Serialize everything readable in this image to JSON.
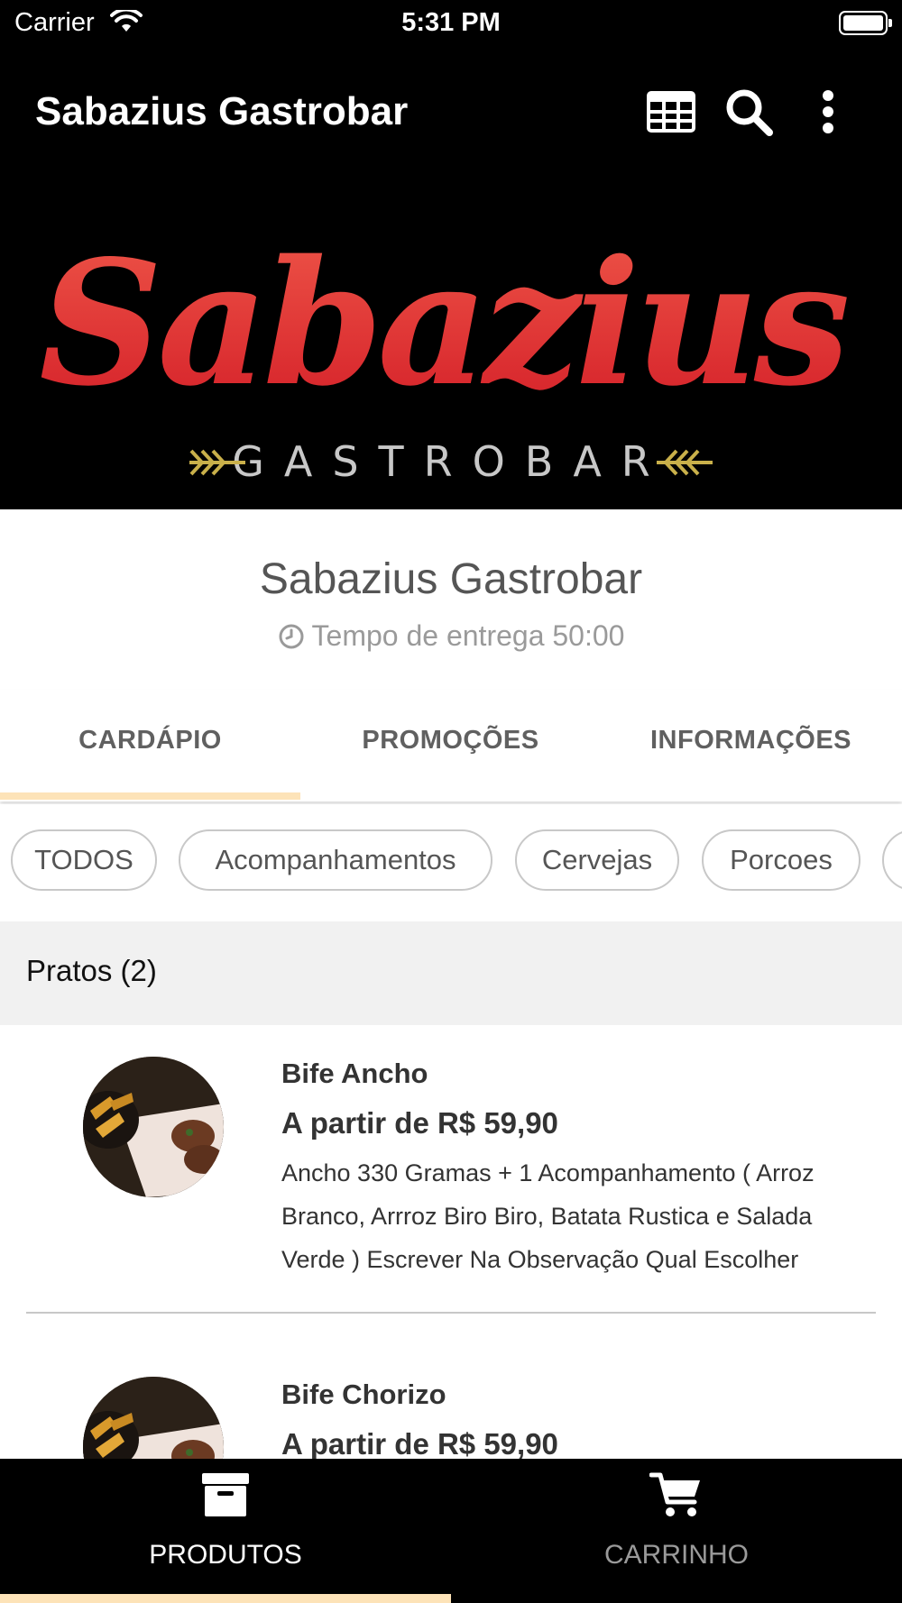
{
  "status_bar": {
    "carrier": "Carrier",
    "time": "5:31 PM"
  },
  "app_bar": {
    "title": "Sabazius Gastrobar"
  },
  "banner": {
    "logo_script": "Sabazius",
    "logo_subtitle": "GASTROBAR"
  },
  "store": {
    "name": "Sabazius Gastrobar",
    "delivery_time": "Tempo de entrega 50:00"
  },
  "tabs": [
    {
      "label": "CARDÁPIO",
      "active": true
    },
    {
      "label": "PROMOÇÕES",
      "active": false
    },
    {
      "label": "INFORMAÇÕES",
      "active": false
    }
  ],
  "categories": [
    "TODOS",
    "Acompanhamentos",
    "Cervejas",
    "Porcoes"
  ],
  "section": {
    "title": "Pratos (2)"
  },
  "products": [
    {
      "name": "Bife Ancho",
      "price": "A partir de R$ 59,90",
      "description": "Ancho 330 Gramas + 1 Acompanhamento ( Arroz Branco, Arrroz Biro Biro, Batata Rustica e Salada Verde ) Escrever Na Observação Qual Escolher"
    },
    {
      "name": "Bife Chorizo",
      "price": "A partir de R$ 59,90"
    }
  ],
  "bottom_nav": [
    {
      "label": "PRODUTOS",
      "icon": "archive-box-icon",
      "active": true
    },
    {
      "label": "CARRINHO",
      "icon": "cart-icon",
      "active": false
    }
  ],
  "colors": {
    "header_bg": "#000000",
    "active_indicator": "#fde3b8",
    "logo_red": "#e0242b",
    "logo_gold": "#c9b04a"
  }
}
